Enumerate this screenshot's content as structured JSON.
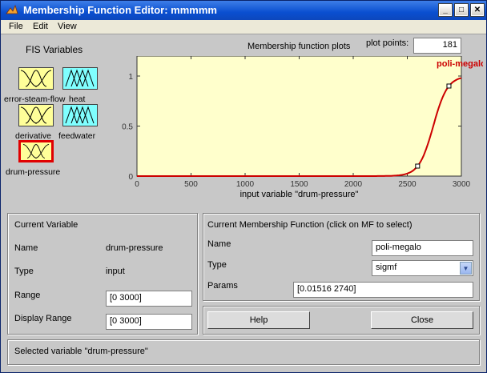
{
  "window": {
    "title": "Membership Function Editor: mmmmm",
    "controls": {
      "minimize": "_",
      "maximize": "□",
      "close": "✕"
    }
  },
  "menu": [
    "File",
    "Edit",
    "View"
  ],
  "fis": {
    "title": "FIS Variables",
    "variables": [
      {
        "label": "error-steam-flow",
        "color": "#ffff99",
        "kind": "input"
      },
      {
        "label": "heat",
        "color": "#80ffff",
        "kind": "output"
      },
      {
        "label": "derivative",
        "color": "#ffff99",
        "kind": "input"
      },
      {
        "label": "feedwater",
        "color": "#80ffff",
        "kind": "output"
      },
      {
        "label": "drum-pressure",
        "color": "#ffff99",
        "kind": "input",
        "selected": true
      }
    ]
  },
  "plot": {
    "header": "Membership function plots",
    "points_label": "plot points:",
    "points_value": "181",
    "mf_label": "poli-megalo",
    "mf_color": "#cc0000"
  },
  "chart_data": {
    "type": "line",
    "xlabel": "input variable \"drum-pressure\"",
    "xlim": [
      0,
      3000
    ],
    "ylim": [
      0,
      1
    ],
    "xticks": [
      "0",
      "500",
      "1000",
      "1500",
      "2000",
      "2500",
      "3000"
    ],
    "yticks": [
      "0",
      "0.5",
      "1"
    ],
    "series": [
      {
        "name": "poli-megalo",
        "function": "sigmf",
        "a": 0.01516,
        "c": 2740,
        "handles_x": [
          2595,
          2885
        ]
      }
    ]
  },
  "current_variable": {
    "title": "Current Variable",
    "name_label": "Name",
    "name_value": "drum-pressure",
    "type_label": "Type",
    "type_value": "input",
    "range_label": "Range",
    "range_value": "[0 3000]",
    "display_range_label": "Display Range",
    "display_range_value": "[0 3000]"
  },
  "current_mf": {
    "title": "Current Membership Function (click on MF to select)",
    "name_label": "Name",
    "name_value": "poli-megalo",
    "type_label": "Type",
    "type_value": "sigmf",
    "params_label": "Params",
    "params_value": "[0.01516 2740]"
  },
  "buttons": {
    "help": "Help",
    "close": "Close"
  },
  "status": "Selected variable \"drum-pressure\""
}
